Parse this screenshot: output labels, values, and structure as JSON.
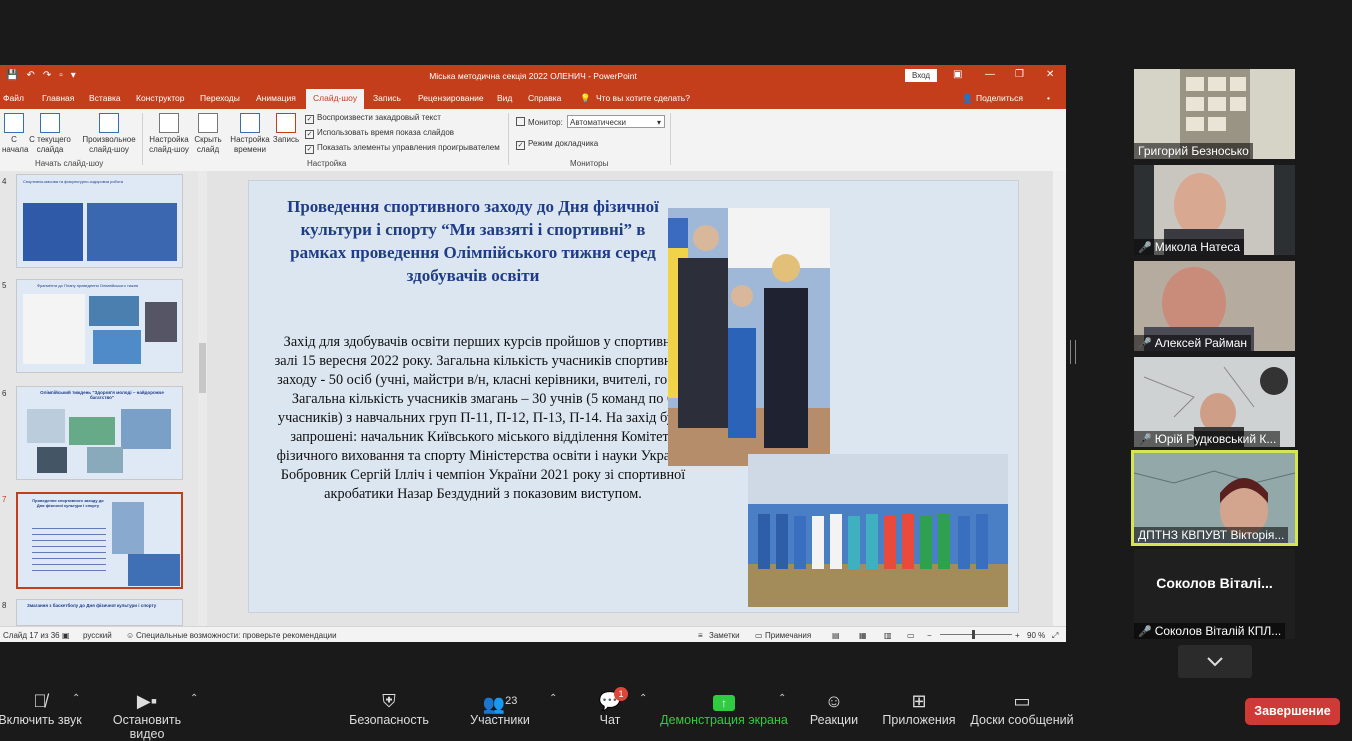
{
  "ppt": {
    "window_title": "Міська методична секція 2022 ОЛЕНИЧ  -  PowerPoint",
    "login": "Вход",
    "share": "Поделиться",
    "menu": [
      "Файл",
      "Главная",
      "Вставка",
      "Конструктор",
      "Переходы",
      "Анимация",
      "Слайд-шоу",
      "Запись",
      "Рецензирование",
      "Вид",
      "Справка",
      "Что вы хотите сделать?"
    ],
    "active_menu": "Слайд-шоу",
    "ribbon": {
      "start": [
        "С начала",
        "С текущего слайда",
        "Произвольное слайд-шоу"
      ],
      "start_group": "Начать слайд-шоу",
      "setup": [
        "Настройка слайд-шоу",
        "Скрыть слайд",
        "Настройка времени",
        "Запись"
      ],
      "setup_group": "Настройка",
      "checks": [
        "Воспроизвести закадровый текст",
        "Использовать время показа слайдов",
        "Показать элементы управления проигрывателем"
      ],
      "monitor_label": "Монитор:",
      "monitor_value": "Автоматически",
      "presenter": "Режим докладчика",
      "monitors_group": "Мониторы"
    },
    "thumbs": [
      {
        "num": "4",
        "title": "Спортивно-масова та фізкультурно-оздоровча робота"
      },
      {
        "num": "5",
        "title": "Фрагменти до Плану проведення Олімпійського тижня"
      },
      {
        "num": "6",
        "title": "Олімпійський тиждень \"Здоров'я молоді – найдорожче багатство\""
      },
      {
        "num": "7",
        "title": "Проведення спортивного заходу до Дня фізичної культури і спорту"
      },
      {
        "num": "8",
        "title": "Змагання з баскетболу до Дня фізичної культури і спорту"
      }
    ],
    "slide": {
      "title": "Проведення спортивного заходу до Дня фізичної культури і спорту “Ми завзяті і спортивні” в рамках проведення Олімпійського тижня серед здобувачів освіти",
      "body": "Захід для здобувачів освіти перших курсів пройшов у спортивній залі 15 вересня 2022 року. Загальна кількість учасників спортивного заходу - 50 осіб (учні, майстри в/н, класні керівники, вчителі, гості) Загальна кількість учасників змагань – 30 учнів (5 команд по 6 учасників) з навчальних груп П-11, П-12, П-13, П-14. На захід були запрошені: начальник Київського міського відділення Комітету фізичного виховання та спорту Міністерства освіти і науки України Бобровник Сергій Ілліч і чемпіон України 2021 року зі спортивної акробатики Назар Бездудний з показовим виступом."
    },
    "status": {
      "slide_of": "Слайд 17 из 36",
      "lang": "русский",
      "accessibility": "Специальные возможности: проверьте рекомендации",
      "notes": "Заметки",
      "comments": "Примечания",
      "zoom": "90 %"
    }
  },
  "participants": [
    {
      "name": "Григорий Безносько",
      "muted": false
    },
    {
      "name": "Микола Натеса",
      "muted": true
    },
    {
      "name": "Алексей Райман",
      "muted": true
    },
    {
      "name": "Юрій Рудковський К...",
      "muted": true
    },
    {
      "name": "ДПТНЗ КВПУВТ Вікторія...",
      "muted": false
    },
    {
      "name": "Соколов Віталій КПЛ...",
      "muted": true,
      "display": "Соколов Віталі..."
    }
  ],
  "toolbar": {
    "unmute": "Включить звук",
    "video": "Остановить видео",
    "security": "Безопасность",
    "participants": "Участники",
    "participants_count": "23",
    "chat": "Чат",
    "chat_badge": "1",
    "share": "Демонстрация экрана",
    "reactions": "Реакции",
    "apps": "Приложения",
    "whiteboards": "Доски сообщений",
    "end": "Завершение"
  }
}
